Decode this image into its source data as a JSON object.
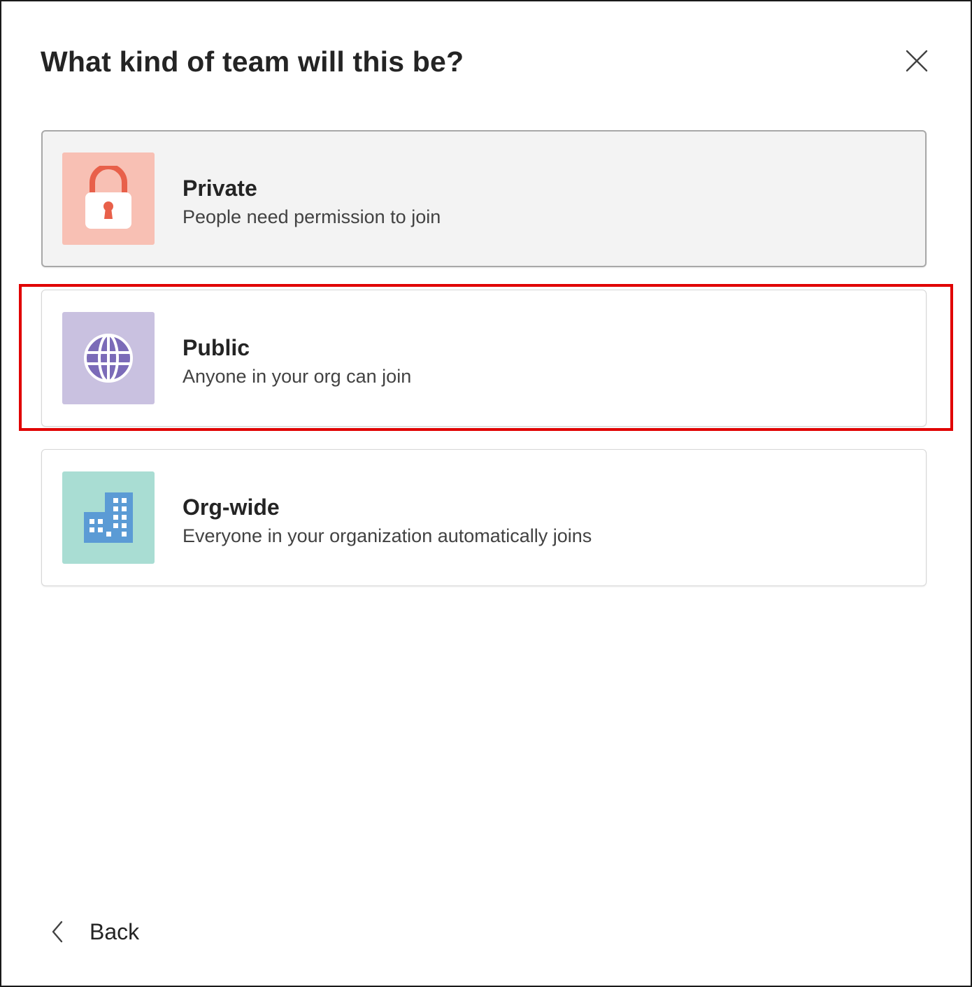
{
  "dialog": {
    "title": "What kind of team will this be?",
    "close_icon": "close-icon"
  },
  "options": [
    {
      "title": "Private",
      "description": "People need permission to join",
      "icon": "lock-icon",
      "tile_color": "#f8c0b4",
      "icon_color": "#e8604a"
    },
    {
      "title": "Public",
      "description": "Anyone in your org can join",
      "icon": "globe-icon",
      "tile_color": "#c9c1e0",
      "icon_color": "#7b6bb8"
    },
    {
      "title": "Org-wide",
      "description": "Everyone in your organization automatically joins",
      "icon": "building-icon",
      "tile_color": "#a9ddd3",
      "icon_color": "#5b9bd5"
    }
  ],
  "footer": {
    "back_label": "Back",
    "back_icon": "chevron-left-icon"
  },
  "annotation": {
    "highlight_color": "#e00000"
  }
}
